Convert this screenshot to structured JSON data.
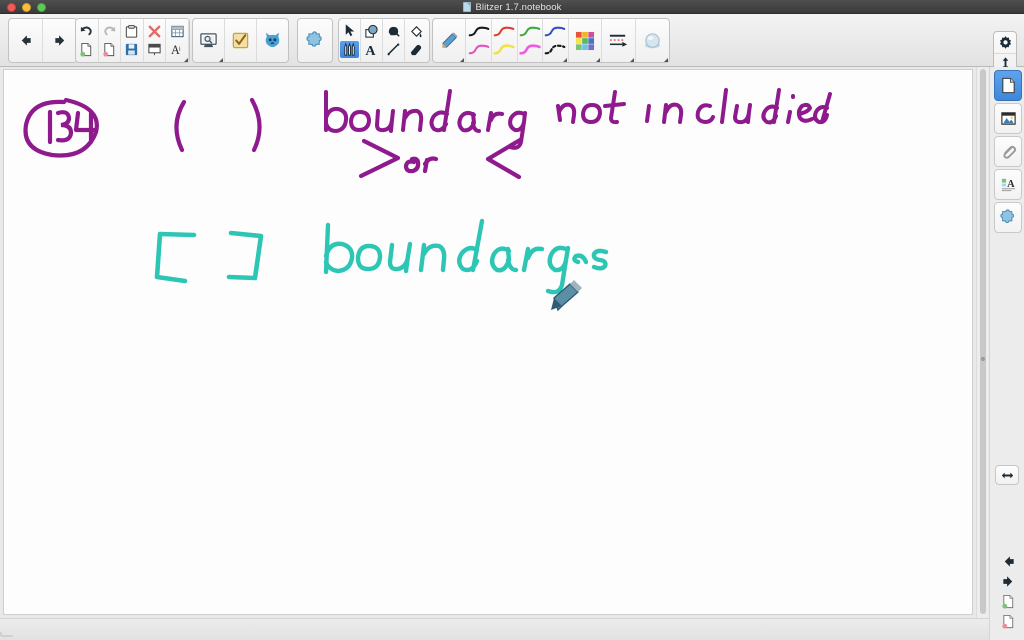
{
  "window": {
    "title": "Blitzer 1.7.notebook",
    "doc_icon": "document-icon",
    "traffic_lights": [
      "close",
      "minimize",
      "zoom"
    ]
  },
  "toolbar": {
    "groups": [
      {
        "name": "navigation",
        "buttons": [
          {
            "name": "previous-page-button",
            "icon": "arrow-left-icon",
            "label": "Previous Page"
          },
          {
            "name": "next-page-button",
            "icon": "arrow-right-icon",
            "label": "Next Page"
          }
        ]
      },
      {
        "name": "edit",
        "buttons": [
          {
            "name": "undo-button",
            "icon": "undo-icon",
            "label": "Undo"
          },
          {
            "name": "new-page-button",
            "icon": "new-page-icon",
            "label": "Add Page"
          },
          {
            "name": "redo-button",
            "icon": "redo-icon",
            "label": "Redo"
          },
          {
            "name": "delete-page-button",
            "icon": "delete-page-icon",
            "label": "Delete Page"
          },
          {
            "name": "paste-button",
            "icon": "paste-icon",
            "label": "Paste"
          },
          {
            "name": "save-button",
            "icon": "save-icon",
            "label": "Save"
          },
          {
            "name": "delete-button",
            "icon": "delete-x-icon",
            "label": "Delete"
          },
          {
            "name": "screen-shade-button",
            "icon": "screen-shade-icon",
            "label": "Screen Shade"
          },
          {
            "name": "table-button",
            "icon": "table-icon",
            "label": "Table"
          },
          {
            "name": "font-button",
            "icon": "font-icon",
            "label": "Font"
          }
        ]
      },
      {
        "name": "tools-extra",
        "buttons": [
          {
            "name": "screen-capture-button",
            "icon": "screen-capture-icon",
            "label": "Screen Capture"
          },
          {
            "name": "response-button",
            "icon": "checkbox-icon",
            "label": "Response"
          },
          {
            "name": "smart-exchange-button",
            "icon": "blue-cat-icon",
            "label": "SMART Exchange"
          }
        ]
      },
      {
        "name": "addons",
        "buttons": [
          {
            "name": "add-ons-button",
            "icon": "puzzle-icon",
            "label": "Add-ons"
          }
        ]
      },
      {
        "name": "drawing-tools",
        "buttons": [
          {
            "name": "select-tool",
            "icon": "cursor-arrow-icon",
            "label": "Select"
          },
          {
            "name": "pens-tool",
            "icon": "pens-icon",
            "label": "Pens",
            "selected": true
          },
          {
            "name": "shapes-tool",
            "icon": "shapes-icon",
            "label": "Shapes"
          },
          {
            "name": "text-tool",
            "icon": "text-a-icon",
            "label": "Text"
          },
          {
            "name": "shape-pen-tool",
            "icon": "shape-pen-icon",
            "label": "Shape Pen"
          },
          {
            "name": "lines-tool",
            "icon": "line-icon",
            "label": "Lines"
          },
          {
            "name": "fill-tool",
            "icon": "paint-bucket-icon",
            "label": "Fill"
          },
          {
            "name": "eraser-tool",
            "icon": "eraser-icon",
            "label": "Eraser"
          }
        ]
      },
      {
        "name": "pen-styles",
        "pencil": {
          "name": "pencil-button",
          "icon": "pencil-icon",
          "label": "Pencil"
        },
        "swatches": [
          {
            "name": "pen-swatch-black",
            "color": "#1a1a1a"
          },
          {
            "name": "pen-swatch-magenta",
            "color": "#e24fc0"
          },
          {
            "name": "pen-swatch-red",
            "color": "#e03b2f"
          },
          {
            "name": "pen-swatch-yellow",
            "color": "#f2e04a"
          },
          {
            "name": "pen-swatch-green",
            "color": "#3fa83f"
          },
          {
            "name": "pen-swatch-pink",
            "color": "#f05ae0"
          },
          {
            "name": "pen-swatch-blue",
            "color": "#3350cc"
          },
          {
            "name": "pen-swatch-dotted",
            "color": "#1a1a1a"
          }
        ],
        "palette": {
          "name": "color-palette-button",
          "icon": "color-grid-icon",
          "label": "Color"
        },
        "line-props": {
          "name": "line-properties-button",
          "icon": "line-style-icon",
          "label": "Line Style"
        },
        "transparency": {
          "name": "transparency-button",
          "icon": "fill-orb-icon",
          "label": "Transparency"
        }
      }
    ],
    "controls": [
      {
        "name": "customize-toolbar-button",
        "icon": "gear-icon",
        "label": "Customize Toolbar"
      },
      {
        "name": "move-toolbar-button",
        "icon": "arrows-vertical-icon",
        "label": "Move Toolbar"
      }
    ]
  },
  "side_panel": {
    "tabs": [
      {
        "name": "page-sorter-tab",
        "icon": "page-icon",
        "label": "Page Sorter",
        "active": true
      },
      {
        "name": "gallery-tab",
        "icon": "gallery-icon",
        "label": "Gallery",
        "active": false
      },
      {
        "name": "attachments-tab",
        "icon": "paperclip-icon",
        "label": "Attachments",
        "active": false
      },
      {
        "name": "properties-tab",
        "icon": "properties-icon",
        "label": "Properties",
        "active": false
      },
      {
        "name": "addons-tab",
        "icon": "puzzle-icon",
        "label": "Add-ons",
        "active": false
      }
    ],
    "collapse": {
      "name": "collapse-panel-button",
      "icon": "arrows-horizontal-icon",
      "label": "Auto-hide"
    },
    "page_nav": [
      {
        "name": "page-back-button",
        "icon": "arrow-left-icon",
        "label": "Back"
      },
      {
        "name": "page-forward-button",
        "icon": "arrow-right-icon",
        "label": "Forward"
      },
      {
        "name": "page-add-button",
        "icon": "new-page-icon",
        "label": "Add Page"
      },
      {
        "name": "page-delete-button",
        "icon": "delete-page-icon",
        "label": "Delete Page"
      }
    ]
  },
  "canvas": {
    "ink_colors": {
      "purple": "#8e1a8e",
      "teal": "#2dc6b4"
    },
    "annotations": [
      {
        "name": "circled-number",
        "text": "134",
        "color": "#8e1a8e",
        "shape": "ellipse"
      },
      {
        "name": "open-parentheses",
        "text": "( )",
        "color": "#8e1a8e"
      },
      {
        "name": "boundary-not-included-note",
        "text": "boundary not included",
        "color": "#8e1a8e"
      },
      {
        "name": "inequality-symbols-note",
        "text": "> or <",
        "color": "#8e1a8e"
      },
      {
        "name": "square-brackets",
        "text": "[ ]",
        "color": "#2dc6b4"
      },
      {
        "name": "boundary-is-note",
        "text": "boundary is",
        "color": "#2dc6b4"
      }
    ],
    "cursor": {
      "name": "pen-cursor",
      "icon": "pen-cursor-icon"
    }
  },
  "scrollbar": {
    "name": "vertical-scrollbar",
    "orientation": "vertical"
  }
}
